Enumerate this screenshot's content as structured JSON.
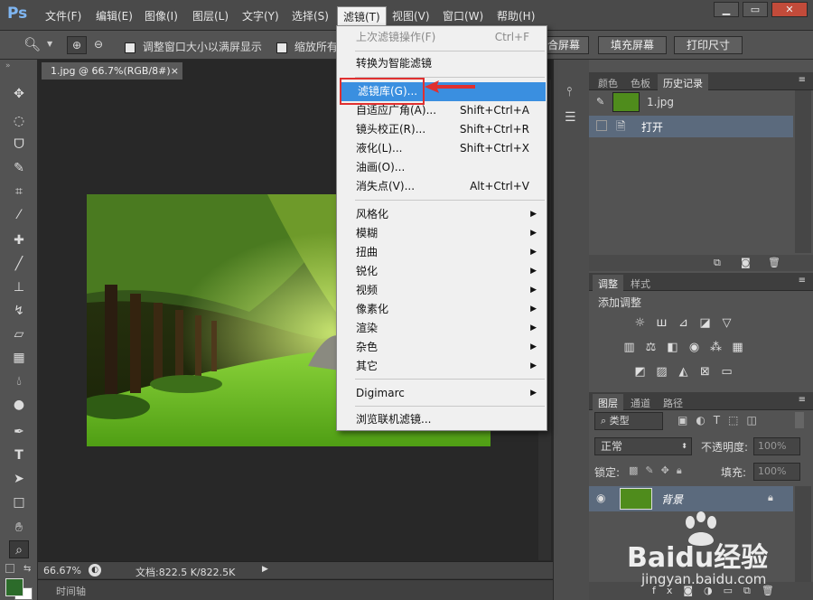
{
  "app": {
    "logo": "Ps"
  },
  "menubar": {
    "items": [
      "文件(F)",
      "编辑(E)",
      "图像(I)",
      "图层(L)",
      "文字(Y)",
      "选择(S)",
      "滤镜(T)",
      "视图(V)",
      "窗口(W)",
      "帮助(H)"
    ],
    "window_controls": [
      "▁",
      "▭",
      "✕"
    ]
  },
  "options": {
    "check1": "调整窗口大小以满屏显示",
    "check2": "缩放所有",
    "btn_fill_window": "合屏幕",
    "btn_fill_screen": "填充屏幕",
    "btn_print": "打印尺寸"
  },
  "document": {
    "tab_title": "1.jpg @ 66.7%(RGB/8#)",
    "tab_close": "×",
    "zoom": "66.67%",
    "doc_info": "文档:822.5 K/822.5K",
    "timeline": "时间轴"
  },
  "filter_menu": {
    "last_filter": {
      "label": "上次滤镜操作(F)",
      "shortcut": "Ctrl+F"
    },
    "smart": "转换为智能滤镜",
    "gallery": "滤镜库(G)...",
    "items_a": [
      {
        "label": "自适应广角(A)...",
        "shortcut": "Shift+Ctrl+A"
      },
      {
        "label": "镜头校正(R)...",
        "shortcut": "Shift+Ctrl+R"
      },
      {
        "label": "液化(L)...",
        "shortcut": "Shift+Ctrl+X"
      },
      {
        "label": "油画(O)...",
        "shortcut": ""
      },
      {
        "label": "消失点(V)...",
        "shortcut": "Alt+Ctrl+V"
      }
    ],
    "submenus": [
      "风格化",
      "模糊",
      "扭曲",
      "锐化",
      "视频",
      "像素化",
      "渲染",
      "杂色",
      "其它"
    ],
    "digimarc": "Digimarc",
    "browse": "浏览联机滤镜..."
  },
  "panels": {
    "history_tabs": [
      "颜色",
      "色板",
      "历史记录"
    ],
    "history_snapshot": "1.jpg",
    "history_step": "打开",
    "adjust_tabs": [
      "调整",
      "样式"
    ],
    "adjust_title": "添加调整",
    "layers_tabs": [
      "图层",
      "通道",
      "路径"
    ],
    "kind_label": "类型",
    "blend_mode": "正常",
    "opacity_label": "不透明度:",
    "opacity_value": "100%",
    "lock_label": "锁定:",
    "fill_label": "填充:",
    "fill_value": "100%",
    "layer_name": "背景"
  },
  "watermark": {
    "brand": "Baidu经验",
    "url": "jingyan.baidu.com"
  },
  "colors": {
    "highlight": "#3a8fe0",
    "annotation": "#e03030"
  }
}
